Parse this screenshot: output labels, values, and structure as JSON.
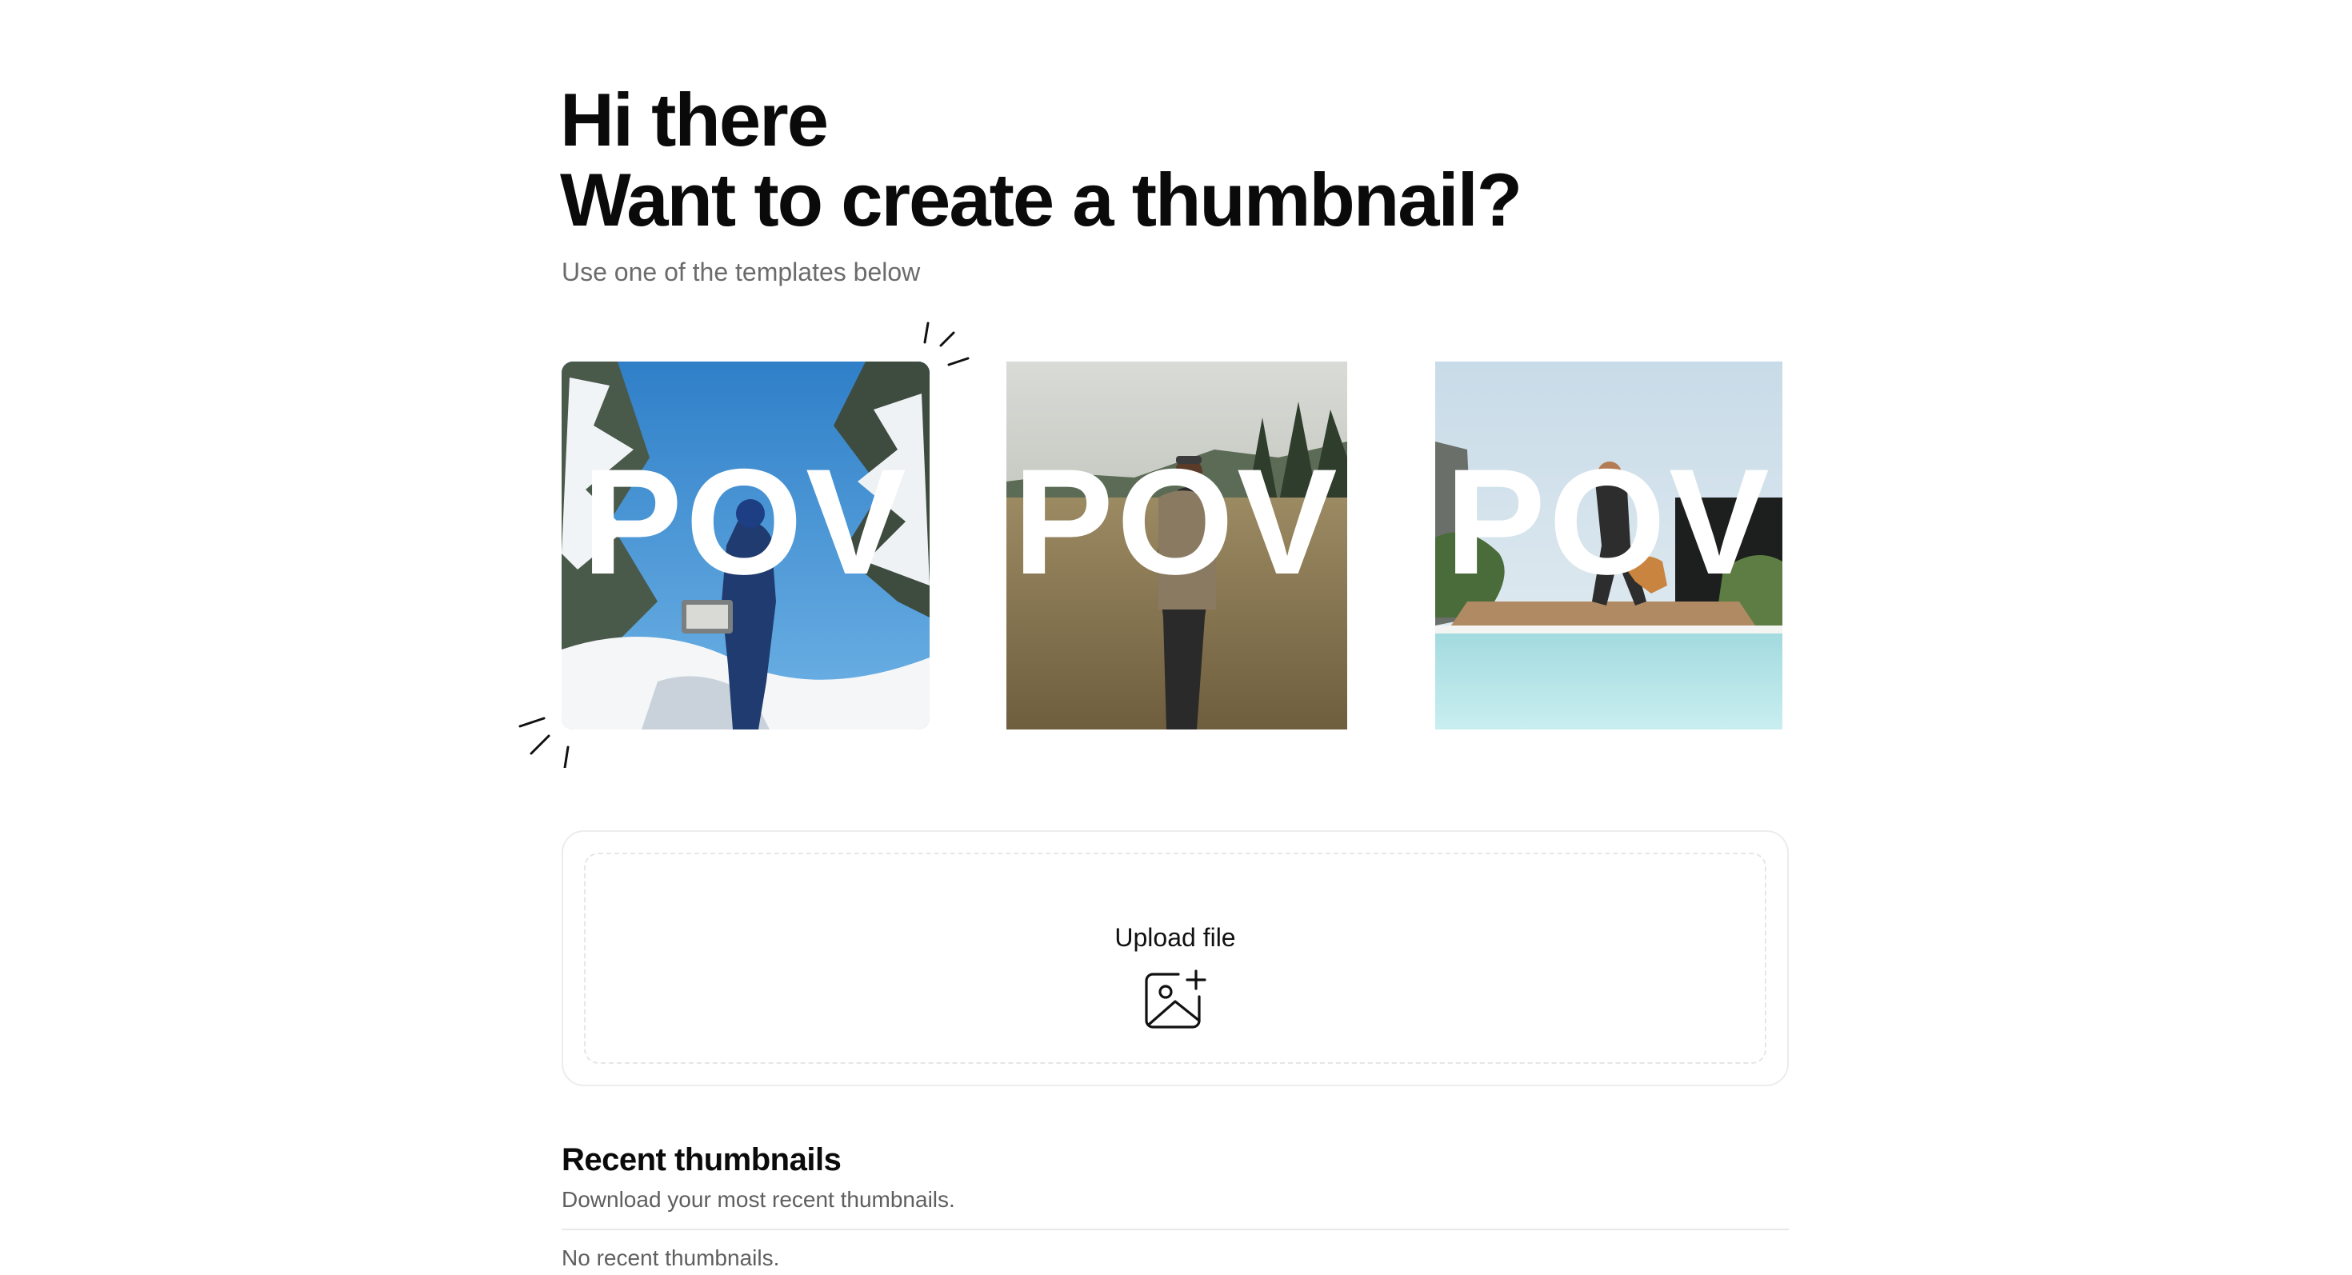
{
  "header": {
    "greeting": "Hi there",
    "headline": "Want to create a thumbnail?",
    "subtitle": "Use one of the templates below"
  },
  "templates": [
    {
      "overlay_text": "POV",
      "scene": "snowy forest hiker",
      "selected": true
    },
    {
      "overlay_text": "POV",
      "scene": "grass field man"
    },
    {
      "overlay_text": "POV",
      "scene": "pool deck man with dog"
    }
  ],
  "upload": {
    "label": "Upload file",
    "icon": "image-plus-icon"
  },
  "recent": {
    "title": "Recent thumbnails",
    "description": "Download your most recent thumbnails.",
    "empty_text": "No recent thumbnails."
  },
  "colors": {
    "text": "#0a0a0a",
    "muted": "#6b6b6b",
    "border": "#ececec",
    "sky": "#3f8fd1",
    "field": "#8c7a55",
    "pool": "#a6dde0"
  }
}
